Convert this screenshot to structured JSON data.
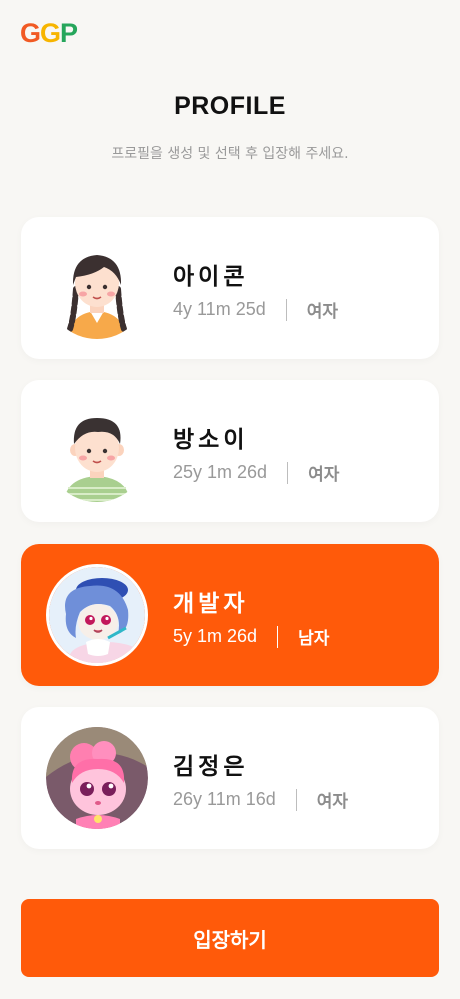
{
  "logo": {
    "letters": [
      "G",
      "G",
      "P"
    ],
    "colors": [
      "#f15a24",
      "#f7b500",
      "#26a65b"
    ]
  },
  "header": {
    "title": "PROFILE",
    "subtitle": "프로필을 생성 및 선택 후 입장해 주세요."
  },
  "profiles": [
    {
      "name": "아이콘",
      "age": "4y 11m 25d",
      "gender": "여자",
      "avatar_icon": "girl-avatar-icon",
      "selected": false
    },
    {
      "name": "방소이",
      "age": "25y 1m 26d",
      "gender": "여자",
      "avatar_icon": "boy-avatar-icon",
      "selected": false
    },
    {
      "name": "개발자",
      "age": "5y 1m 26d",
      "gender": "남자",
      "avatar_icon": "blue-hair-character-icon",
      "selected": true
    },
    {
      "name": "김정은",
      "age": "26y 11m 16d",
      "gender": "여자",
      "avatar_icon": "pink-character-icon",
      "selected": false
    }
  ],
  "footer": {
    "enter_label": "입장하기"
  },
  "colors": {
    "accent": "#ff5a0a",
    "background": "#f8f7f4"
  }
}
